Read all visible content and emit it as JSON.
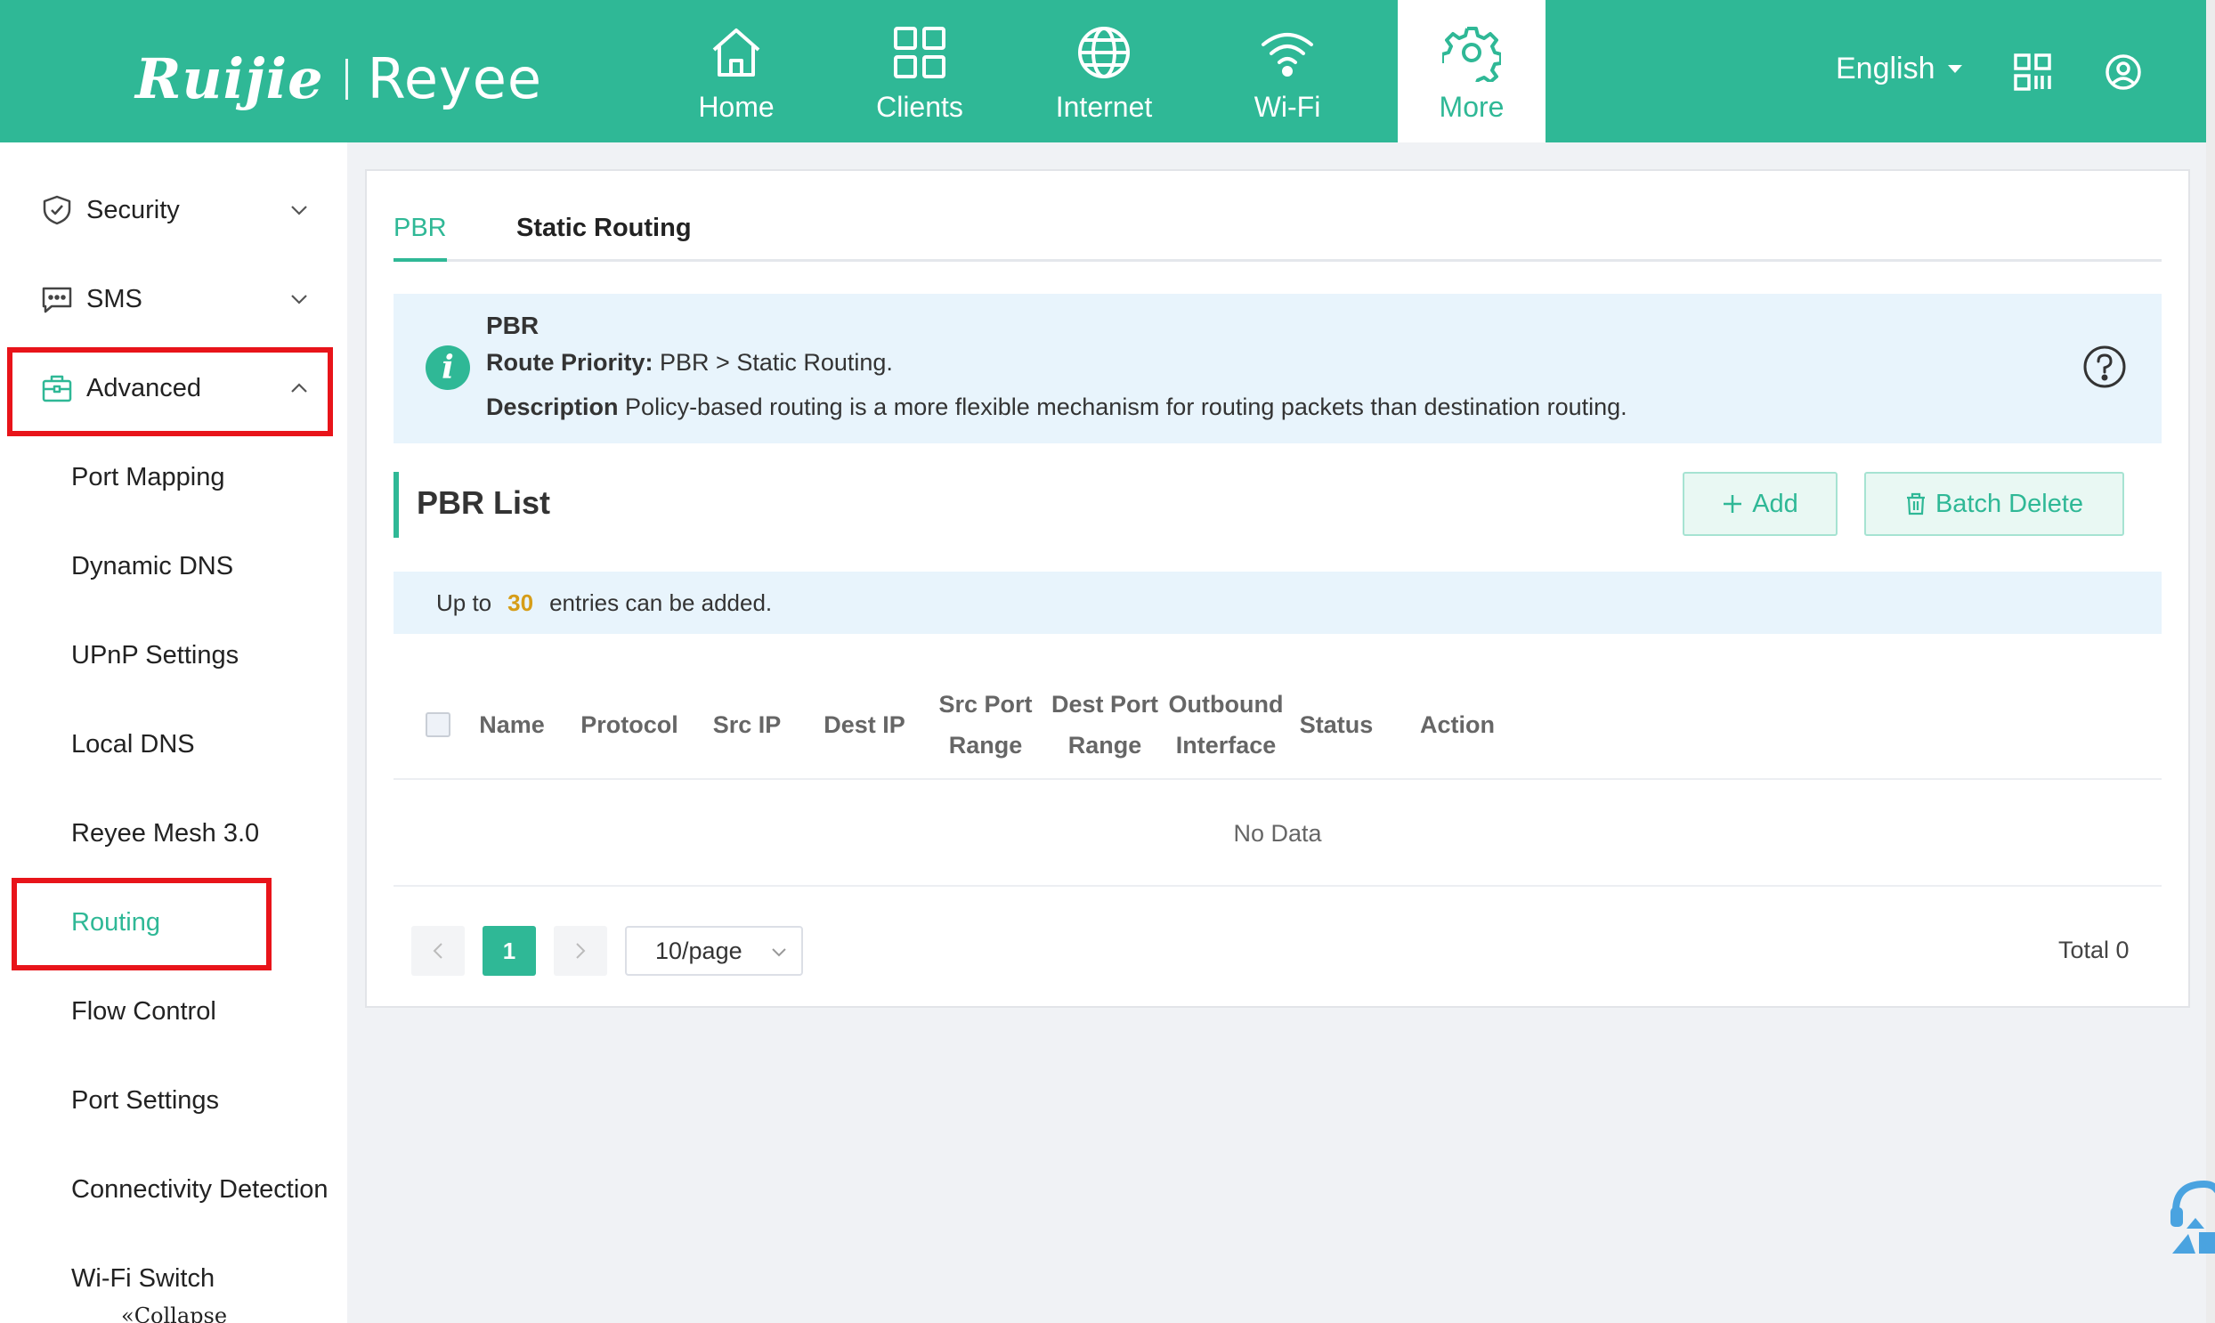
{
  "brand": {
    "left": "Ruijie",
    "right": "Reyee"
  },
  "nav": {
    "items": [
      {
        "label": "Home",
        "icon": "home-icon"
      },
      {
        "label": "Clients",
        "icon": "grid-icon"
      },
      {
        "label": "Internet",
        "icon": "globe-icon"
      },
      {
        "label": "Wi-Fi",
        "icon": "wifi-icon"
      },
      {
        "label": "More",
        "icon": "gear-icon",
        "active": true
      }
    ],
    "language": "English"
  },
  "sidebar": {
    "groups": [
      {
        "label": "Security",
        "icon": "shield-icon",
        "expanded": false
      },
      {
        "label": "SMS",
        "icon": "message-icon",
        "expanded": false
      },
      {
        "label": "Advanced",
        "icon": "toolbox-icon",
        "expanded": true
      }
    ],
    "sub_items": [
      {
        "label": "Port Mapping"
      },
      {
        "label": "Dynamic DNS"
      },
      {
        "label": "UPnP Settings"
      },
      {
        "label": "Local DNS"
      },
      {
        "label": "Reyee Mesh 3.0"
      },
      {
        "label": "Routing",
        "active": true
      },
      {
        "label": "Flow Control"
      },
      {
        "label": "Port Settings"
      },
      {
        "label": "Connectivity Detection"
      },
      {
        "label": "Wi-Fi Switch"
      }
    ],
    "collapse_label": "Collapse"
  },
  "tabs": [
    {
      "label": "PBR",
      "active": true
    },
    {
      "label": "Static Routing",
      "active": false
    }
  ],
  "info": {
    "title": "PBR",
    "priority_label": "Route Priority:",
    "priority_text": "PBR > Static Routing.",
    "description_label": "Description",
    "description_text": "Policy-based routing is a more flexible mechanism for routing packets than destination routing."
  },
  "pbr_list": {
    "title": "PBR List",
    "add_label": "Add",
    "batch_delete_label": "Batch Delete",
    "limit_prefix": "Up to",
    "limit_count": "30",
    "limit_suffix": "entries can be added.",
    "columns": [
      "Name",
      "Protocol",
      "Src IP",
      "Dest IP",
      "Src Port Range",
      "Dest Port Range",
      "Outbound Interface",
      "Status",
      "Action"
    ],
    "empty_text": "No Data",
    "pagination": {
      "current_page": "1",
      "page_size": "10/page",
      "total": "Total 0"
    }
  },
  "colors": {
    "brand": "#2fb896",
    "highlight_box": "#e8141a",
    "limit_number": "#d69d18"
  }
}
